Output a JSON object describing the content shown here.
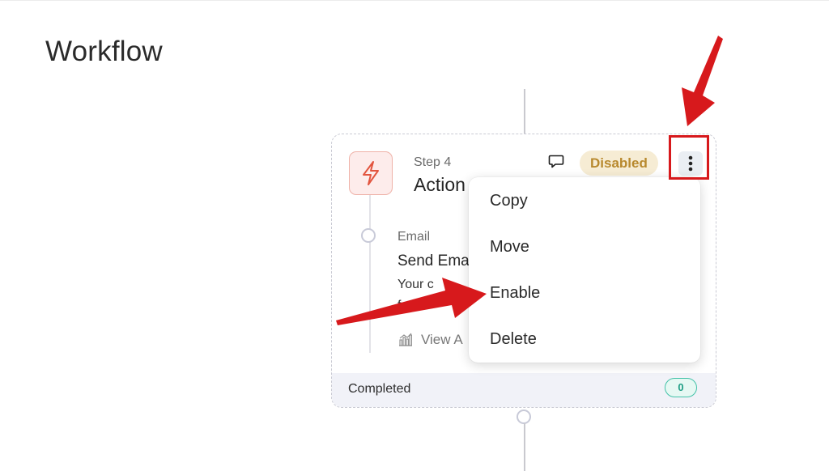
{
  "page": {
    "title": "Workflow"
  },
  "card": {
    "step_label": "Step 4",
    "step_title": "Action",
    "status": "Disabled",
    "action": {
      "type": "Email",
      "name": "Send Ema",
      "description_line1": "Your c",
      "description_line2": "f",
      "analytics_link": "View A"
    },
    "footer": {
      "label": "Completed",
      "count": "0"
    }
  },
  "menu": {
    "items": [
      {
        "label": "Copy"
      },
      {
        "label": "Move"
      },
      {
        "label": "Enable"
      },
      {
        "label": "Delete"
      }
    ]
  },
  "colors": {
    "accent_red": "#d7191c",
    "status_disabled_text": "#b8892e",
    "status_disabled_bg": "#f6ecd4",
    "count_badge_green": "#1f9e85"
  },
  "icons": {
    "step_icon": "lightning-bolt-icon",
    "comment": "comment-bubble-icon",
    "more": "vertical-dots-icon",
    "analytics": "bar-chart-icon"
  }
}
